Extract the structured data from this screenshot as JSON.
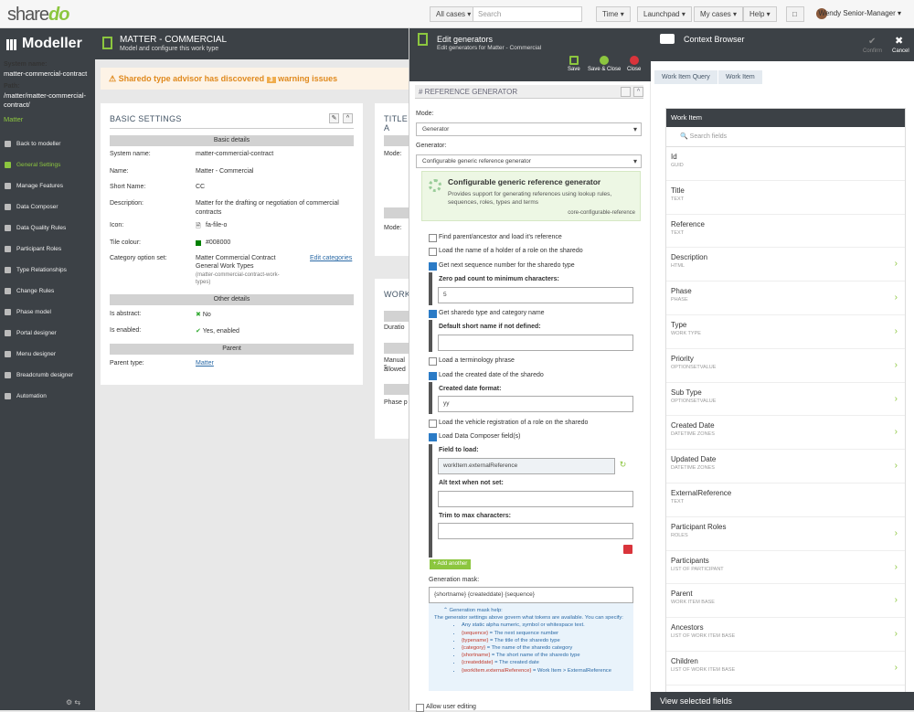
{
  "topbar": {
    "logo_a": "share",
    "logo_b": "do",
    "all_cases": "All cases ▾",
    "search_placeholder": "Search",
    "time": "Time ▾",
    "launchpad": "Launchpad ▾",
    "my_cases": "My cases ▾",
    "help": "Help ▾",
    "user": "Wendy Senior-Manager ▾"
  },
  "sidebar": {
    "title": "Modeller",
    "sysname_label": "System name:",
    "sysname": "matter-commercial-contract",
    "path_label": "Path:",
    "path1": "/matter/matter-commercial-",
    "path2": "contract/",
    "path_value": "Matter",
    "items": [
      {
        "label": "Back to modeller"
      },
      {
        "label": "General Settings"
      },
      {
        "label": "Manage Features"
      },
      {
        "label": "Data Composer"
      },
      {
        "label": "Data Quality Rules"
      },
      {
        "label": "Participant Roles"
      },
      {
        "label": "Type Relationships"
      },
      {
        "label": "Change Rules"
      },
      {
        "label": "Phase model"
      },
      {
        "label": "Portal designer"
      },
      {
        "label": "Menu designer"
      },
      {
        "label": "Breadcrumb designer"
      },
      {
        "label": "Automation"
      }
    ]
  },
  "main": {
    "title": "Matter - Commercial",
    "subtitle": "Model and configure this work type",
    "warn_pre": "Sharedo type advisor has discovered",
    "warn_count": "3",
    "warn_post": "warning issues",
    "basic": {
      "title": "Basic Settings",
      "sect1": "Basic details",
      "sysname_l": "System name:",
      "sysname_v": "matter-commercial-contract",
      "name_l": "Name:",
      "name_v": "Matter - Commercial",
      "short_l": "Short Name:",
      "short_v": "CC",
      "desc_l": "Description:",
      "desc_v1": "Matter for the drafting or negotiation of commercial",
      "desc_v2": "contracts",
      "icon_l": "Icon:",
      "icon_v": "fa-file-o",
      "tile_l": "Tile colour:",
      "tile_v": "#008000",
      "cat_l": "Category option set:",
      "cat_v1": "Matter Commercial Contract",
      "cat_v2": "General Work Types",
      "cat_v3": "(matter-commercial-contract-work-",
      "cat_v4": "types)",
      "cat_link": "Edit categories",
      "sect2": "Other details",
      "abs_l": "Is abstract:",
      "abs_v": "No",
      "en_l": "Is enabled:",
      "en_v": "Yes, enabled",
      "sect3": "Parent",
      "parent_l": "Parent type:",
      "parent_v": "Matter"
    },
    "side": {
      "title": "Title a",
      "mode": "Mode:",
      "mode2": "Mode:",
      "work": "Work",
      "dur": "Duratio",
      "manual1": "Manual s",
      "manual2": "allowed",
      "phase": "Phase p"
    }
  },
  "editor": {
    "title": "Edit generators",
    "subtitle": "Edit generators for Matter - Commercial",
    "save": "Save",
    "saveclose": "Save & Close",
    "close": "Close",
    "section": "Reference Generator",
    "mode_l": "Mode:",
    "mode_v": "Generator",
    "gen_l": "Generator:",
    "gen_v": "Configurable generic reference generator",
    "box_title": "Configurable generic reference generator",
    "box_desc": "Provides support for generating references using lookup rules, sequences, roles, types and terms",
    "box_code": "core-configurable-reference",
    "c1": "Find parent/ancestor and load it's reference",
    "c2": "Load the name of a holder of a role on the sharedo",
    "c3": "Get next sequence number for the sharedo type",
    "zero_l": "Zero pad count to minimum characters:",
    "zero_v": "5",
    "c4": "Get sharedo type and category name",
    "short_l": "Default short name if not defined:",
    "c5": "Load a terminology phrase",
    "c6": "Load the created date of the sharedo",
    "date_l": "Created date format:",
    "date_v": "yy",
    "c7": "Load the vehicle registration of a role on the sharedo",
    "c8": "Load Data Composer field(s)",
    "field_l": "Field to load:",
    "field_v": "workItem.externalReference",
    "alt_l": "Alt text when not set:",
    "trim_l": "Trim to max characters:",
    "add": "+ Add another",
    "mask_l": "Generation mask:",
    "mask_v": "{shortname} {createddate} {sequence}",
    "help_title": "⌃ Generation mask help:",
    "help_intro": "The generator settings above govern what tokens are available. You can specify:",
    "help_static": "Any static alpha numeric, symbol or whitespace text.",
    "tokens": [
      {
        "k": "{sequence}",
        "d": "= The next sequence number"
      },
      {
        "k": "{typename}",
        "d": "= The title of the sharedo type"
      },
      {
        "k": "{category}",
        "d": "= The name of the sharedo category"
      },
      {
        "k": "{shortname}",
        "d": "= The short name of the sharedo type"
      },
      {
        "k": "{createddate}",
        "d": "= The created date"
      },
      {
        "k": "{workItem.externalReference}",
        "d": "= Work Item > ExternalReference"
      }
    ],
    "allow": "Allow user editing"
  },
  "ctx": {
    "title": "Context Browser",
    "confirm": "Confirm",
    "cancel": "Cancel",
    "crumb1": "Work Item Query",
    "crumb2": "Work Item",
    "list_head": "Work Item",
    "search": "Search fields",
    "view": "View selected fields",
    "items": [
      {
        "n": "Id",
        "t": "GUID",
        "c": ""
      },
      {
        "n": "Title",
        "t": "TEXT",
        "c": ""
      },
      {
        "n": "Reference",
        "t": "TEXT",
        "c": ""
      },
      {
        "n": "Description",
        "t": "HTML",
        "c": "›"
      },
      {
        "n": "Phase",
        "t": "PHASE",
        "c": "›"
      },
      {
        "n": "Type",
        "t": "WORK TYPE",
        "c": "›"
      },
      {
        "n": "Priority",
        "t": "OPTIONSETVALUE",
        "c": "›"
      },
      {
        "n": "Sub Type",
        "t": "OPTIONSETVALUE",
        "c": "›"
      },
      {
        "n": "Created Date",
        "t": "DATETIME ZONES",
        "c": "›"
      },
      {
        "n": "Updated Date",
        "t": "DATETIME ZONES",
        "c": "›"
      },
      {
        "n": "ExternalReference",
        "t": "TEXT",
        "c": ""
      },
      {
        "n": "Participant Roles",
        "t": "ROLES",
        "c": "›"
      },
      {
        "n": "Participants",
        "t": "LIST OF PARTICIPANT",
        "c": "›"
      },
      {
        "n": "Parent",
        "t": "WORK ITEM BASE",
        "c": "›"
      },
      {
        "n": "Ancestors",
        "t": "LIST OF WORK ITEM BASE",
        "c": "›"
      },
      {
        "n": "Children",
        "t": "LIST OF WORK ITEM BASE",
        "c": "›"
      }
    ]
  }
}
